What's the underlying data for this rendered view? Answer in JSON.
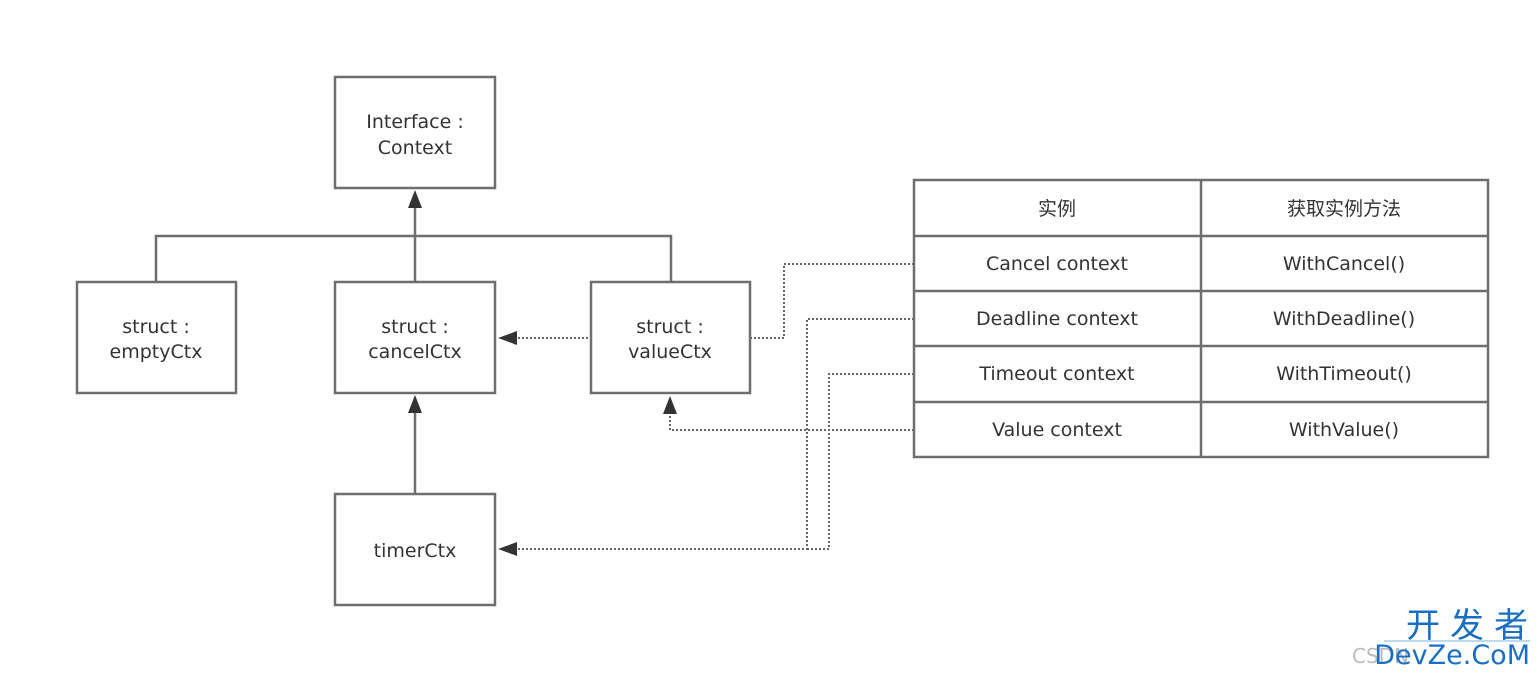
{
  "nodes": {
    "interface": {
      "line1": "Interface :",
      "line2": "Context"
    },
    "empty": {
      "line1": "struct :",
      "line2": "emptyCtx"
    },
    "cancel": {
      "line1": "struct :",
      "line2": "cancelCtx"
    },
    "value": {
      "line1": "struct :",
      "line2": "valueCtx"
    },
    "timer": {
      "line1": "timerCtx"
    }
  },
  "table": {
    "headers": [
      "实例",
      "获取实例方法"
    ],
    "rows": [
      [
        "Cancel context",
        "WithCancel()"
      ],
      [
        "Deadline context",
        "WithDeadline()"
      ],
      [
        "Timeout context",
        "WithTimeout()"
      ],
      [
        "Value context",
        "WithValue()"
      ]
    ]
  },
  "watermark": {
    "line1": "开发者",
    "line2": "DevZe.CoM",
    "csdn": "CSDN"
  }
}
